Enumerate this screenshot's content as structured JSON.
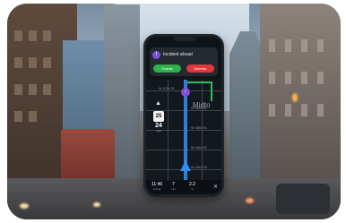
{
  "notification": {
    "icon": "alert-icon",
    "title": "Incident ahead",
    "accept_label": "Enable",
    "decline_label": "Dismiss"
  },
  "map": {
    "street_label_large": "Midto",
    "street_labels": [
      "W 47th St",
      "W 46th St",
      "W 45th St",
      "W 44th St",
      "W 43rd St"
    ]
  },
  "speed": {
    "limit": "25",
    "current": "24",
    "unit": "mph"
  },
  "trip": {
    "stats": [
      {
        "value": "11:46",
        "unit": "arrival"
      },
      {
        "value": "7",
        "unit": "min"
      },
      {
        "value": "2.2",
        "unit": "mi"
      }
    ]
  },
  "colors": {
    "route_blue": "#2f7de0",
    "alt_route_green": "#2fbf5a",
    "accept_green": "#2bb24c",
    "decline_red": "#e0383a",
    "pin_purple": "#7e4fd6"
  }
}
